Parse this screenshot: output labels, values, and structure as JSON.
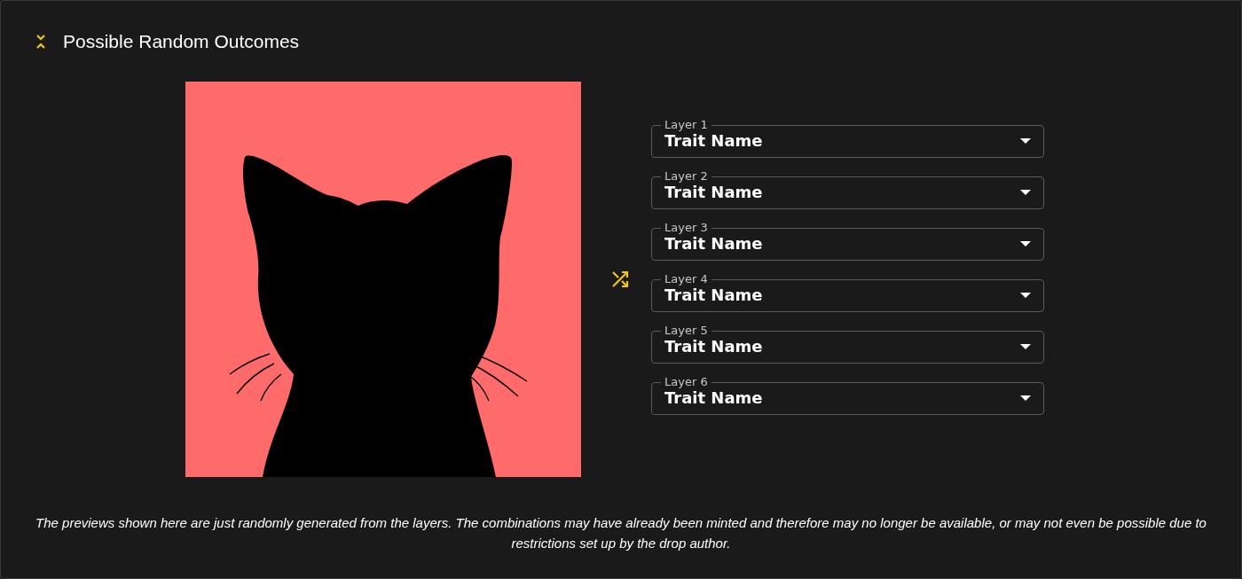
{
  "header": {
    "title": "Possible Random Outcomes"
  },
  "layers": [
    {
      "label": "Layer 1",
      "value": "Trait Name"
    },
    {
      "label": "Layer 2",
      "value": "Trait Name"
    },
    {
      "label": "Layer 3",
      "value": "Trait Name"
    },
    {
      "label": "Layer 4",
      "value": "Trait Name"
    },
    {
      "label": "Layer 5",
      "value": "Trait Name"
    },
    {
      "label": "Layer 6",
      "value": "Trait Name"
    }
  ],
  "disclaimer": "The previews shown here are just randomly generated from the layers. The combinations may have already been minted and therefore may no longer be available, or may not even be possible due to restrictions set up by the drop author."
}
